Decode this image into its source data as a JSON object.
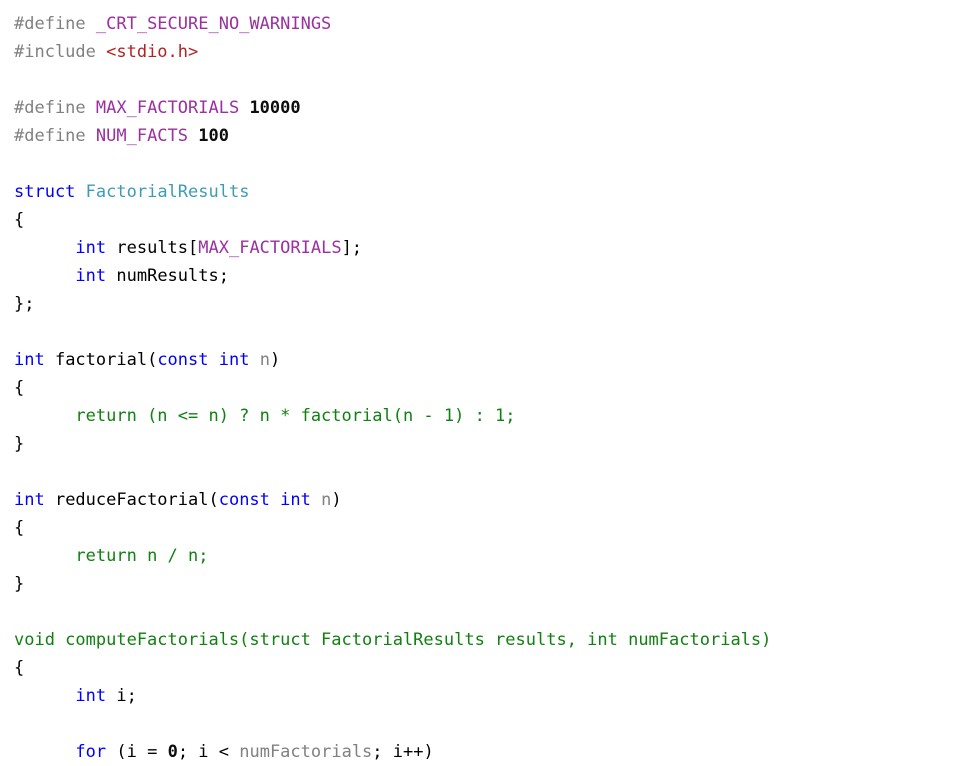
{
  "editor": {
    "language": "C",
    "background_color": "#ffffff",
    "font_size_px": 17,
    "line_height_px": 28,
    "palette": {
      "plain": "#000000",
      "preprocessor": "#808080",
      "macro_name": "#9B30A0",
      "include_path": "#B22222",
      "number_literal": "#0d0d0d",
      "keyword": "#0000FF",
      "type_name": "#3C9CB8",
      "identifier": "#808080",
      "highlight_green": "#108010"
    }
  },
  "lines": [
    {
      "n": 1,
      "tokens": [
        {
          "t": "#define ",
          "c": "preproc"
        },
        {
          "t": "_CRT_SECURE_NO_WARNINGS",
          "c": "macro"
        }
      ]
    },
    {
      "n": 2,
      "tokens": [
        {
          "t": "#include ",
          "c": "preproc"
        },
        {
          "t": "<stdio.h>",
          "c": "string"
        }
      ]
    },
    {
      "n": 3,
      "tokens": [
        {
          "t": " ",
          "c": "blank"
        }
      ]
    },
    {
      "n": 4,
      "tokens": [
        {
          "t": "#define ",
          "c": "preproc"
        },
        {
          "t": "MAX_FACTORIALS",
          "c": "macro"
        },
        {
          "t": " ",
          "c": "plain"
        },
        {
          "t": "10000",
          "c": "number"
        }
      ]
    },
    {
      "n": 5,
      "tokens": [
        {
          "t": "#define ",
          "c": "preproc"
        },
        {
          "t": "NUM_FACTS",
          "c": "macro"
        },
        {
          "t": " ",
          "c": "plain"
        },
        {
          "t": "100",
          "c": "number"
        }
      ]
    },
    {
      "n": 6,
      "tokens": [
        {
          "t": " ",
          "c": "blank"
        }
      ]
    },
    {
      "n": 7,
      "tokens": [
        {
          "t": "struct",
          "c": "keyword"
        },
        {
          "t": " ",
          "c": "plain"
        },
        {
          "t": "FactorialResults",
          "c": "type"
        }
      ]
    },
    {
      "n": 8,
      "tokens": [
        {
          "t": "{",
          "c": "plain"
        }
      ]
    },
    {
      "n": 9,
      "tokens": [
        {
          "t": "      ",
          "c": "plain"
        },
        {
          "t": "int",
          "c": "keyword"
        },
        {
          "t": " results[",
          "c": "plain"
        },
        {
          "t": "MAX_FACTORIALS",
          "c": "macro"
        },
        {
          "t": "];",
          "c": "plain"
        }
      ]
    },
    {
      "n": 10,
      "tokens": [
        {
          "t": "      ",
          "c": "plain"
        },
        {
          "t": "int",
          "c": "keyword"
        },
        {
          "t": " numResults;",
          "c": "plain"
        }
      ]
    },
    {
      "n": 11,
      "tokens": [
        {
          "t": "};",
          "c": "plain"
        }
      ]
    },
    {
      "n": 12,
      "tokens": [
        {
          "t": " ",
          "c": "blank"
        }
      ]
    },
    {
      "n": 13,
      "tokens": [
        {
          "t": "int",
          "c": "keyword"
        },
        {
          "t": " factorial(",
          "c": "plain"
        },
        {
          "t": "const",
          "c": "keyword"
        },
        {
          "t": " ",
          "c": "plain"
        },
        {
          "t": "int",
          "c": "keyword"
        },
        {
          "t": " ",
          "c": "plain"
        },
        {
          "t": "n",
          "c": "ident"
        },
        {
          "t": ")",
          "c": "plain"
        }
      ]
    },
    {
      "n": 14,
      "tokens": [
        {
          "t": "{",
          "c": "plain"
        }
      ]
    },
    {
      "n": 15,
      "tokens": [
        {
          "t": "      ",
          "c": "plain"
        },
        {
          "t": "return (n <= n) ? n * factorial(n - 1) : 1;",
          "c": "green"
        }
      ]
    },
    {
      "n": 16,
      "tokens": [
        {
          "t": "}",
          "c": "plain"
        }
      ]
    },
    {
      "n": 17,
      "tokens": [
        {
          "t": " ",
          "c": "blank"
        }
      ]
    },
    {
      "n": 18,
      "tokens": [
        {
          "t": "int",
          "c": "keyword"
        },
        {
          "t": " reduceFactorial(",
          "c": "plain"
        },
        {
          "t": "const",
          "c": "keyword"
        },
        {
          "t": " ",
          "c": "plain"
        },
        {
          "t": "int",
          "c": "keyword"
        },
        {
          "t": " ",
          "c": "plain"
        },
        {
          "t": "n",
          "c": "ident"
        },
        {
          "t": ")",
          "c": "plain"
        }
      ]
    },
    {
      "n": 19,
      "tokens": [
        {
          "t": "{",
          "c": "plain"
        }
      ]
    },
    {
      "n": 20,
      "tokens": [
        {
          "t": "      ",
          "c": "plain"
        },
        {
          "t": "return n / n;",
          "c": "green"
        }
      ]
    },
    {
      "n": 21,
      "tokens": [
        {
          "t": "}",
          "c": "plain"
        }
      ]
    },
    {
      "n": 22,
      "tokens": [
        {
          "t": " ",
          "c": "blank"
        }
      ]
    },
    {
      "n": 23,
      "tokens": [
        {
          "t": "void computeFactorials(struct FactorialResults results, int numFactorials)",
          "c": "green"
        }
      ]
    },
    {
      "n": 24,
      "tokens": [
        {
          "t": "{",
          "c": "plain"
        }
      ]
    },
    {
      "n": 25,
      "tokens": [
        {
          "t": "      ",
          "c": "plain"
        },
        {
          "t": "int",
          "c": "keyword"
        },
        {
          "t": " i;",
          "c": "plain"
        }
      ]
    },
    {
      "n": 26,
      "tokens": [
        {
          "t": " ",
          "c": "blank"
        }
      ]
    },
    {
      "n": 27,
      "tokens": [
        {
          "t": "      ",
          "c": "plain"
        },
        {
          "t": "for",
          "c": "keyword"
        },
        {
          "t": " (i = ",
          "c": "plain"
        },
        {
          "t": "0",
          "c": "number"
        },
        {
          "t": "; i < ",
          "c": "plain"
        },
        {
          "t": "numFactorials",
          "c": "ident"
        },
        {
          "t": "; i++)",
          "c": "plain"
        }
      ]
    }
  ]
}
